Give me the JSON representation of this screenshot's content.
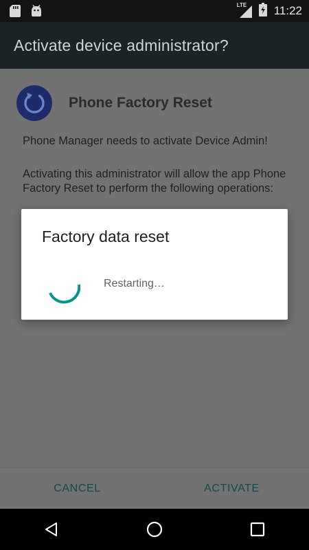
{
  "status_bar": {
    "time": "11:22",
    "network": "LTE",
    "icons": [
      "sd-card-icon",
      "android-debug-icon",
      "lte-signal-icon",
      "battery-icon"
    ]
  },
  "action_bar": {
    "title": "Activate device administrator?"
  },
  "app": {
    "name": "Phone Factory Reset",
    "icon": "refresh-icon"
  },
  "content": {
    "message": "Phone Manager needs to activate Device Admin!",
    "description": "Activating this administrator will allow the app Phone Factory Reset to perform the following operations:"
  },
  "footer": {
    "cancel_label": "CANCEL",
    "activate_label": "ACTIVATE"
  },
  "dialog": {
    "title": "Factory data reset",
    "message": "Restarting…"
  },
  "nav_bar": {
    "icons": [
      "back-icon",
      "home-icon",
      "recents-icon"
    ]
  },
  "colors": {
    "accent": "#009688",
    "button_text": "#0f4d45",
    "app_icon_bg": "#1d2b6b",
    "dim_overlay": "#727272"
  }
}
